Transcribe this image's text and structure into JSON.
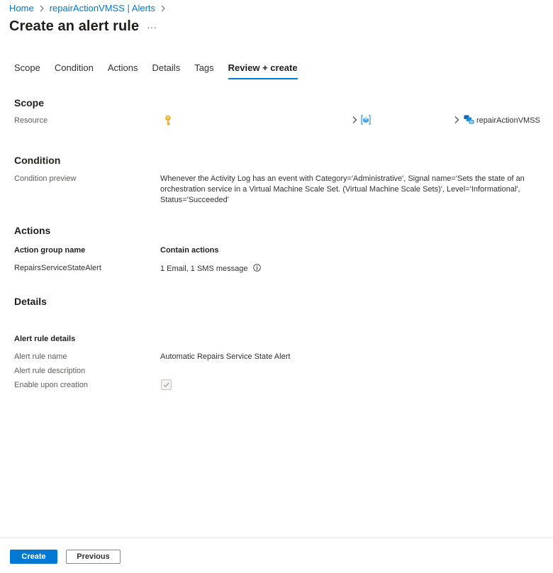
{
  "breadcrumb": {
    "items": [
      "Home",
      "repairActionVMSS | Alerts"
    ]
  },
  "header": {
    "title": "Create an alert rule",
    "more_label": "···"
  },
  "tabs": [
    {
      "label": "Scope"
    },
    {
      "label": "Condition"
    },
    {
      "label": "Actions"
    },
    {
      "label": "Details"
    },
    {
      "label": "Tags"
    },
    {
      "label": "Review + create",
      "active": true
    }
  ],
  "scope": {
    "heading": "Scope",
    "resource_label": "Resource",
    "resource_name": "repairActionVMSS"
  },
  "condition": {
    "heading": "Condition",
    "preview_label": "Condition preview",
    "preview_lines": [
      "Whenever the Activity Log has an event with Category='Administrative', Signal name='Sets the state of an",
      "orchestration service in a Virtual Machine Scale Set. (Virtual Machine Scale Sets)', Level='Informational',",
      "Status='Succeeded'"
    ]
  },
  "actions": {
    "heading": "Actions",
    "col_group": "Action group name",
    "col_actions": "Contain actions",
    "group_name": "RepairsServiceStateAlert",
    "contain_actions": "1 Email, 1 SMS message"
  },
  "details": {
    "heading": "Details",
    "subheading": "Alert rule details",
    "name_label": "Alert rule name",
    "name_value": "Automatic Repairs Service State Alert",
    "description_label": "Alert rule description",
    "enable_label": "Enable upon creation",
    "enable_checked": true
  },
  "footer": {
    "create_label": "Create",
    "previous_label": "Previous"
  },
  "colors": {
    "accent": "#0078d4",
    "key_icon": "#f2b11e",
    "vm_icon": "#50a8e6"
  }
}
